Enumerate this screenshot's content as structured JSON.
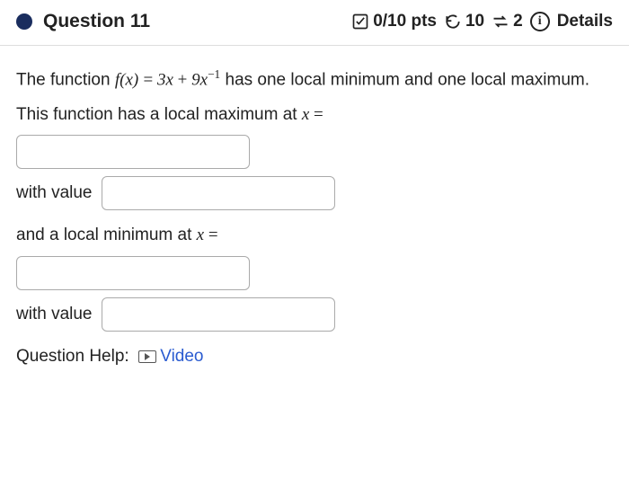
{
  "header": {
    "title": "Question 11",
    "score": "0/10 pts",
    "attempts_remaining": "10",
    "resubmit_count": "2",
    "details_label": "Details"
  },
  "problem": {
    "func_lhs": "f(x)",
    "func_rhs_a": "3x",
    "func_rhs_plus": " + ",
    "func_rhs_b": "9x",
    "func_rhs_exp": "−1",
    "intro_tail": " has one local minimum and one local maximum.",
    "line2_pre": "This function has a local maximum at ",
    "var_x": "x",
    "equals_sign_1": " =",
    "with_value_1": "with value",
    "line3_pre": "and a local minimum at ",
    "equals_sign_2": " =",
    "with_value_2": "with value",
    "help_label": "Question Help:",
    "video_label": "Video"
  },
  "inputs": {
    "max_x": "",
    "max_val": "",
    "min_x": "",
    "min_val": ""
  }
}
